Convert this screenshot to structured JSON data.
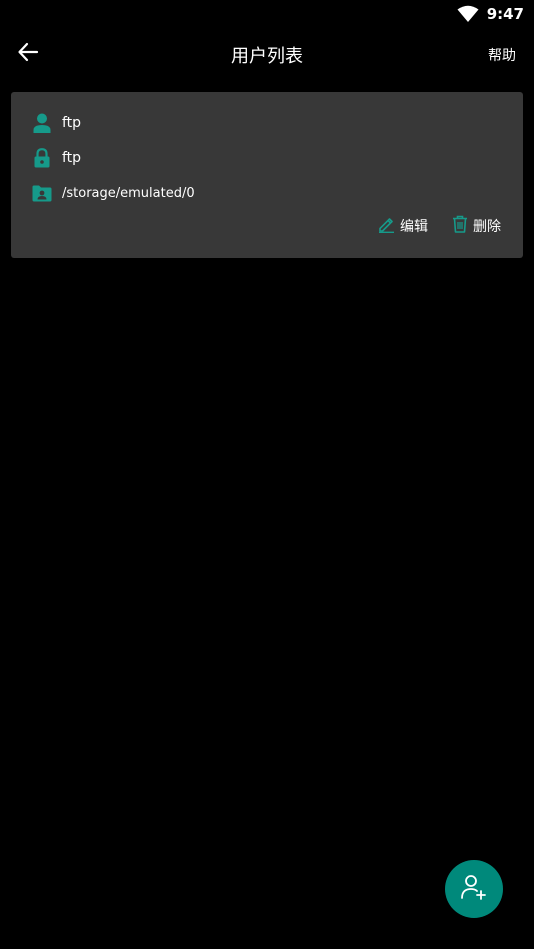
{
  "status_bar": {
    "time": "9:47"
  },
  "toolbar": {
    "title": "用户列表",
    "help_label": "帮助"
  },
  "users": [
    {
      "username": "ftp",
      "password": "ftp",
      "path": "/storage/emulated/0",
      "edit_label": "编辑",
      "delete_label": "删除"
    }
  ],
  "colors": {
    "accent": "#00897b",
    "card_bg": "#383838",
    "icon_teal": "#169a8a",
    "background": "#000000"
  },
  "icons": {
    "back": "arrow-left-icon",
    "user": "person-icon",
    "password": "lock-icon",
    "path": "folder-account-icon",
    "edit": "pencil-icon",
    "delete": "trash-icon",
    "fab": "add-user-icon"
  }
}
